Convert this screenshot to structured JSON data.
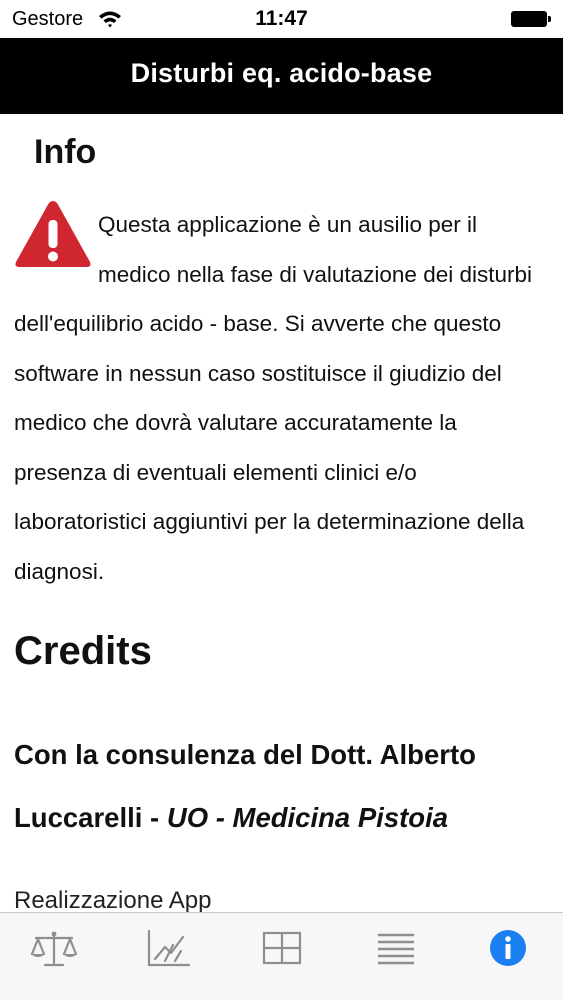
{
  "status_bar": {
    "carrier": "Gestore",
    "time": "11:47"
  },
  "nav": {
    "title": "Disturbi eq. acido-base"
  },
  "info": {
    "heading": "Info",
    "icon": "warning-triangle-icon",
    "icon_color": "#d0262f",
    "text": "Questa applicazione è un ausilio per il medico nella fase di valutazione dei disturbi dell'equilibrio acido - base. Si avverte che questo software in nessun caso sostituisce il giudizio del medico che dovrà valutare accuratamente la presenza di eventuali elementi clinici e/o laboratoristici aggiuntivi per la determinazione della diagnosi."
  },
  "credits": {
    "heading": "Credits",
    "consult_prefix": "Con la consulenza del Dott. Alberto Luccarelli - ",
    "consult_affiliation": "UO - Medicina Pistoia",
    "realization_label": "Realizzazione App"
  },
  "tab_bar": {
    "active_color": "#1a7ff0",
    "inactive_color": "#8e8e8e",
    "tabs": [
      {
        "icon": "balance-scale-icon",
        "active": false
      },
      {
        "icon": "chart-icon",
        "active": false
      },
      {
        "icon": "grid-icon",
        "active": false
      },
      {
        "icon": "list-icon",
        "active": false
      },
      {
        "icon": "info-icon",
        "active": true
      }
    ]
  }
}
